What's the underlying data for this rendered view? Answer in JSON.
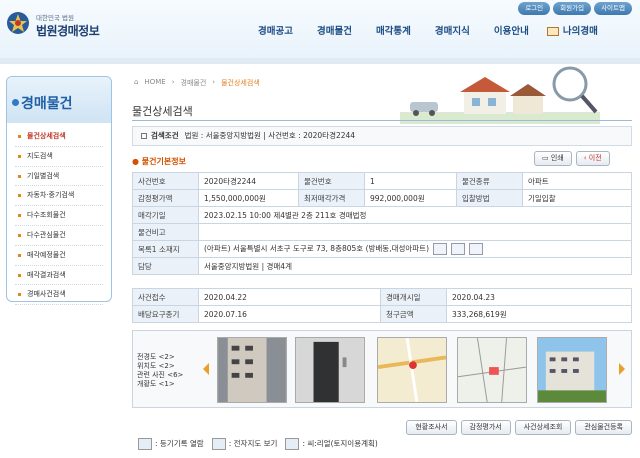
{
  "header": {
    "logo_small": "대한민국 법원",
    "logo_title": "법원경매정보",
    "util_links": [
      "로그인",
      "회원가입",
      "사이트맵"
    ],
    "nav": [
      "경매공고",
      "경매물건",
      "매각통계",
      "경매지식",
      "이용안내",
      "나의경매"
    ]
  },
  "sidebar": {
    "title": "경매물건",
    "items": [
      {
        "label": "물건상세검색",
        "active": true
      },
      {
        "label": "지도검색"
      },
      {
        "label": "기일별검색"
      },
      {
        "label": "자동차·중기검색"
      },
      {
        "label": "다수조회물건"
      },
      {
        "label": "다수관심물건"
      },
      {
        "label": "매각예정물건"
      },
      {
        "label": "매각결과검색"
      },
      {
        "label": "경매사건검색"
      }
    ]
  },
  "breadcrumb": [
    "HOME",
    "경매물건",
    "물건상세검색"
  ],
  "page_title": "물건상세검색",
  "search_condition": {
    "label": "검색조건",
    "text": "법원 : 서울중앙지방법원 | 사건번호 : 2020타경2244"
  },
  "section_title": "물건기본정보",
  "buttons": {
    "print": "인쇄",
    "prev": "이전"
  },
  "info": {
    "case_no_label": "사건번호",
    "case_no": "2020타경2244",
    "item_no_label": "물건번호",
    "item_no": "1",
    "item_type_label": "물건종류",
    "item_type": "아파트",
    "appraisal_label": "감정평가액",
    "appraisal": "1,550,000,000원",
    "min_price_label": "최저매각가격",
    "min_price": "992,000,000원",
    "bid_method_label": "입찰방법",
    "bid_method": "기일입찰",
    "sale_date_label": "매각기일",
    "sale_date": "2023.02.15 10:00 제4별관 2층 211호 경매법정",
    "remark_label": "물건비고",
    "remark": "",
    "address_label": "목록1 소재지",
    "address": "(아파트) 서울특별시 서초구 도구로 73, 8층805호 (방배동,대성아파트)",
    "manager_label": "담당",
    "manager": "서울중앙지방법원 | 경매4계"
  },
  "dates": {
    "received_label": "사건접수",
    "received": "2020.04.22",
    "start_label": "경매개시일",
    "start": "2020.04.23",
    "deadline_label": "배당요구종기",
    "deadline": "2020.07.16",
    "claim_label": "청구금액",
    "claim": "333,268,619원"
  },
  "photo_labels": [
    "전경도 <2>",
    "위치도 <2>",
    "관련 사진 <6>",
    "개황도 <1>"
  ],
  "bottom_buttons": [
    "현황조사서",
    "감정평가서",
    "사건상세조회",
    "관심물건등록"
  ],
  "legend": [
    "등기기록 열람",
    "전자지도 보기",
    "씨:리얼(토지이용계획)"
  ]
}
